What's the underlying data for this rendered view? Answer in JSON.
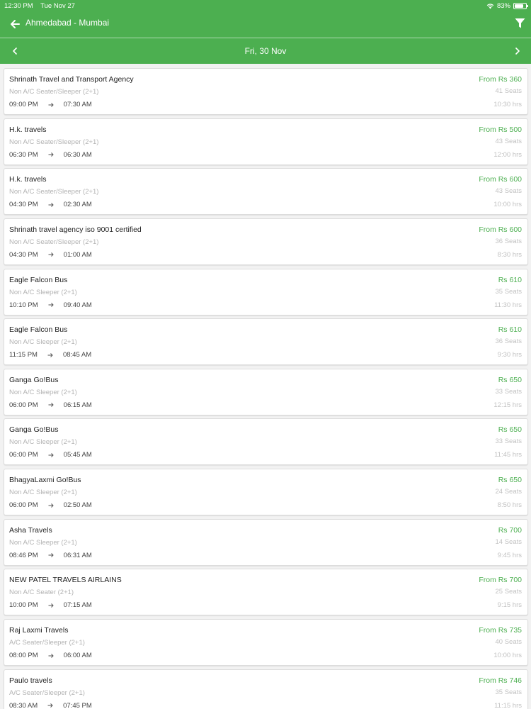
{
  "status": {
    "time": "12:30 PM",
    "date": "Tue Nov 27",
    "battery": "83%",
    "battery_level": 0.83
  },
  "header": {
    "route": "Ahmedabad - Mumbai"
  },
  "date_bar": {
    "date": "Fri, 30 Nov"
  },
  "icons": {
    "back": "arrow-left-icon",
    "filter": "filter-funnel-icon",
    "prev": "chevron-left-icon",
    "next": "chevron-right-icon",
    "wifi": "wifi-icon",
    "battery": "battery-icon",
    "arrow": "arrow-right-icon"
  },
  "colors": {
    "primary": "#4caf50",
    "price": "#4caf50"
  },
  "buses": [
    {
      "name": "Shrinath Travel and Transport Agency",
      "type": "Non A/C Seater/Sleeper (2+1)",
      "departure": "09:00 PM",
      "arrival": "07:30 AM",
      "price": "From Rs 360",
      "seats": "41 Seats",
      "duration": "10:30 hrs"
    },
    {
      "name": "H.k. travels",
      "type": "Non A/C Seater/Sleeper (2+1)",
      "departure": "06:30 PM",
      "arrival": "06:30 AM",
      "price": "From Rs 500",
      "seats": "43 Seats",
      "duration": "12:00 hrs"
    },
    {
      "name": "H.k. travels",
      "type": "Non A/C Seater/Sleeper (2+1)",
      "departure": "04:30 PM",
      "arrival": "02:30 AM",
      "price": "From Rs 600",
      "seats": "43 Seats",
      "duration": "10:00 hrs"
    },
    {
      "name": "Shrinath travel agency iso 9001 certified",
      "type": "Non A/C Seater/Sleeper (2+1)",
      "departure": "04:30 PM",
      "arrival": "01:00 AM",
      "price": "From Rs 600",
      "seats": "36 Seats",
      "duration": "8:30 hrs"
    },
    {
      "name": "Eagle Falcon Bus",
      "type": "Non A/C Sleeper  (2+1)",
      "departure": "10:10 PM",
      "arrival": "09:40 AM",
      "price": "Rs 610",
      "seats": "35 Seats",
      "duration": "11:30 hrs"
    },
    {
      "name": "Eagle Falcon Bus",
      "type": "Non A/C Sleeper  (2+1)",
      "departure": "11:15 PM",
      "arrival": "08:45 AM",
      "price": "Rs 610",
      "seats": "36 Seats",
      "duration": "9:30 hrs"
    },
    {
      "name": "Ganga Go!Bus",
      "type": "Non A/C Sleeper  (2+1)",
      "departure": "06:00 PM",
      "arrival": "06:15 AM",
      "price": "Rs 650",
      "seats": "33 Seats",
      "duration": "12:15 hrs"
    },
    {
      "name": "Ganga Go!Bus",
      "type": "Non A/C Sleeper  (2+1)",
      "departure": "06:00 PM",
      "arrival": "05:45 AM",
      "price": "Rs 650",
      "seats": "33 Seats",
      "duration": "11:45 hrs"
    },
    {
      "name": "BhagyaLaxmi Go!Bus",
      "type": "Non A/C Sleeper  (2+1)",
      "departure": "06:00 PM",
      "arrival": "02:50 AM",
      "price": "Rs 650",
      "seats": "24 Seats",
      "duration": "8:50 hrs"
    },
    {
      "name": "Asha Travels",
      "type": "Non A/C Sleeper  (2+1)",
      "departure": "08:46 PM",
      "arrival": "06:31 AM",
      "price": "Rs 700",
      "seats": "14 Seats",
      "duration": "9:45 hrs"
    },
    {
      "name": "NEW PATEL TRAVELS AIRLAINS",
      "type": "Non A/C Seater (2+1)",
      "departure": "10:00 PM",
      "arrival": "07:15 AM",
      "price": "From Rs 700",
      "seats": "25 Seats",
      "duration": "9:15 hrs"
    },
    {
      "name": "Raj Laxmi Travels",
      "type": "A/C Seater/Sleeper (2+1)",
      "departure": "08:00 PM",
      "arrival": "06:00 AM",
      "price": "From Rs 735",
      "seats": "40 Seats",
      "duration": "10:00 hrs"
    },
    {
      "name": "Paulo travels",
      "type": "A/C Seater/Sleeper (2+1)",
      "departure": "08:30 AM",
      "arrival": "07:45 PM",
      "price": "From Rs 746",
      "seats": "35 Seats",
      "duration": "11:15 hrs"
    }
  ]
}
